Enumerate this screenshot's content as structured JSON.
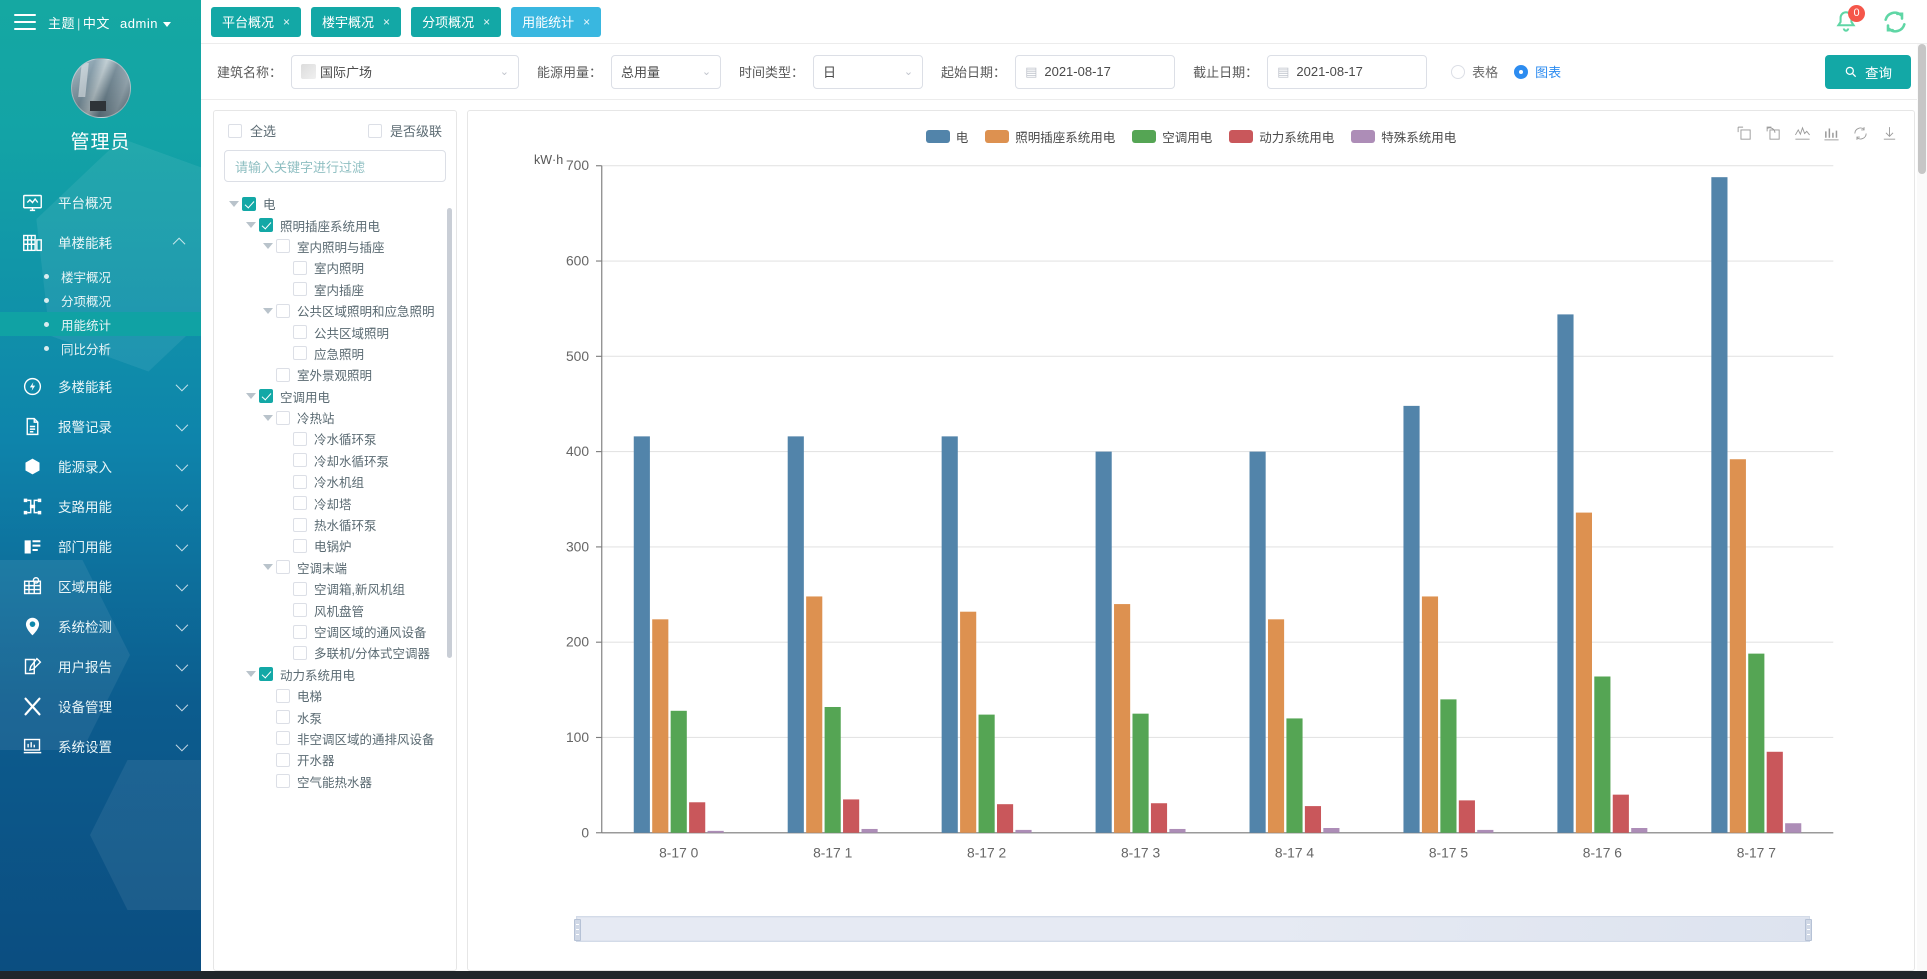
{
  "sidebar": {
    "header": {
      "theme_label": "主题",
      "separator": "|",
      "lang_label": "中文",
      "user": "admin"
    },
    "user_name": "管理员",
    "items": [
      {
        "label": "平台概况",
        "icon": "monitor-icon",
        "expandable": false
      },
      {
        "label": "单楼能耗",
        "icon": "building-icon",
        "expandable": true,
        "expanded": true,
        "children": [
          {
            "label": "楼宇概况",
            "active": false
          },
          {
            "label": "分项概况",
            "active": false
          },
          {
            "label": "用能统计",
            "active": true
          },
          {
            "label": "同比分析",
            "active": false
          }
        ]
      },
      {
        "label": "多楼能耗",
        "icon": "bolt-circle-icon",
        "expandable": true
      },
      {
        "label": "报警记录",
        "icon": "document-icon",
        "expandable": true
      },
      {
        "label": "能源录入",
        "icon": "hexagon-icon",
        "expandable": true
      },
      {
        "label": "支路用能",
        "icon": "nodes-icon",
        "expandable": true
      },
      {
        "label": "部门用能",
        "icon": "folder-icon",
        "expandable": true
      },
      {
        "label": "区域用能",
        "icon": "map-grid-icon",
        "expandable": true
      },
      {
        "label": "系统检测",
        "icon": "location-pin-icon",
        "expandable": true
      },
      {
        "label": "用户报告",
        "icon": "edit-square-icon",
        "expandable": true
      },
      {
        "label": "设备管理",
        "icon": "tools-icon",
        "expandable": true
      },
      {
        "label": "系统设置",
        "icon": "settings-monitor-icon",
        "expandable": true
      }
    ]
  },
  "topbar": {
    "tabs": [
      {
        "label": "平台概况",
        "active": false,
        "close": "×"
      },
      {
        "label": "楼宇概况",
        "active": false,
        "close": "×"
      },
      {
        "label": "分项概况",
        "active": false,
        "close": "×"
      },
      {
        "label": "用能统计",
        "active": true,
        "close": "×"
      }
    ],
    "notification_count": "0"
  },
  "filters": {
    "building": {
      "label": "建筑名称：",
      "value": "国际广场"
    },
    "energy": {
      "label": "能源用量：",
      "value": "总用量"
    },
    "timetype": {
      "label": "时间类型：",
      "value": "日"
    },
    "start": {
      "label": "起始日期：",
      "value": "2021-08-17"
    },
    "end": {
      "label": "截止日期：",
      "value": "2021-08-17"
    },
    "view_table": "表格",
    "view_chart": "图表",
    "view_selected": "图表",
    "search_button": "查询"
  },
  "tree": {
    "select_all": "全选",
    "cascade": "是否级联",
    "filter_placeholder": "请输入关键字进行过滤",
    "nodes": [
      {
        "label": "电",
        "depth": 0,
        "checked": true,
        "expandable": true
      },
      {
        "label": "照明插座系统用电",
        "depth": 1,
        "checked": true,
        "expandable": true
      },
      {
        "label": "室内照明与插座",
        "depth": 2,
        "checked": false,
        "expandable": true
      },
      {
        "label": "室内照明",
        "depth": 3,
        "checked": false,
        "expandable": false
      },
      {
        "label": "室内插座",
        "depth": 3,
        "checked": false,
        "expandable": false
      },
      {
        "label": "公共区域照明和应急照明",
        "depth": 2,
        "checked": false,
        "expandable": true
      },
      {
        "label": "公共区域照明",
        "depth": 3,
        "checked": false,
        "expandable": false
      },
      {
        "label": "应急照明",
        "depth": 3,
        "checked": false,
        "expandable": false
      },
      {
        "label": "室外景观照明",
        "depth": 2,
        "checked": false,
        "expandable": false
      },
      {
        "label": "空调用电",
        "depth": 1,
        "checked": true,
        "expandable": true
      },
      {
        "label": "冷热站",
        "depth": 2,
        "checked": false,
        "expandable": true
      },
      {
        "label": "冷水循环泵",
        "depth": 3,
        "checked": false,
        "expandable": false
      },
      {
        "label": "冷却水循环泵",
        "depth": 3,
        "checked": false,
        "expandable": false
      },
      {
        "label": "冷水机组",
        "depth": 3,
        "checked": false,
        "expandable": false
      },
      {
        "label": "冷却塔",
        "depth": 3,
        "checked": false,
        "expandable": false
      },
      {
        "label": "热水循环泵",
        "depth": 3,
        "checked": false,
        "expandable": false
      },
      {
        "label": "电锅炉",
        "depth": 3,
        "checked": false,
        "expandable": false
      },
      {
        "label": "空调末端",
        "depth": 2,
        "checked": false,
        "expandable": true
      },
      {
        "label": "空调箱,新风机组",
        "depth": 3,
        "checked": false,
        "expandable": false
      },
      {
        "label": "风机盘管",
        "depth": 3,
        "checked": false,
        "expandable": false
      },
      {
        "label": "空调区域的通风设备",
        "depth": 3,
        "checked": false,
        "expandable": false
      },
      {
        "label": "多联机/分体式空调器",
        "depth": 3,
        "checked": false,
        "expandable": false
      },
      {
        "label": "动力系统用电",
        "depth": 1,
        "checked": true,
        "expandable": true
      },
      {
        "label": "电梯",
        "depth": 2,
        "checked": false,
        "expandable": false
      },
      {
        "label": "水泵",
        "depth": 2,
        "checked": false,
        "expandable": false
      },
      {
        "label": "非空调区域的通排风设备",
        "depth": 2,
        "checked": false,
        "expandable": false
      },
      {
        "label": "开水器",
        "depth": 2,
        "checked": false,
        "expandable": false
      },
      {
        "label": "空气能热水器",
        "depth": 2,
        "checked": false,
        "expandable": false
      }
    ]
  },
  "chart_toolbox": [
    "datazoom-select-icon",
    "datazoom-restore-icon",
    "line-chart-icon",
    "bar-chart-icon",
    "restore-icon",
    "save-image-icon"
  ],
  "chart_data": {
    "type": "bar",
    "title": "",
    "xlabel": "",
    "ylabel": "kW·h",
    "ylim": [
      0,
      700
    ],
    "yticks": [
      0,
      100,
      200,
      300,
      400,
      500,
      600,
      700
    ],
    "grid": true,
    "legend_position": "top-center",
    "categories": [
      "8-17 0",
      "8-17 1",
      "8-17 2",
      "8-17 3",
      "8-17 4",
      "8-17 5",
      "8-17 6",
      "8-17 7"
    ],
    "series": [
      {
        "name": "电",
        "color": "#5284aa",
        "values": [
          416,
          416,
          416,
          400,
          400,
          448,
          544,
          688
        ]
      },
      {
        "name": "照明插座系统用电",
        "color": "#dd9150",
        "values": [
          224,
          248,
          232,
          240,
          224,
          248,
          336,
          392
        ]
      },
      {
        "name": "空调用电",
        "color": "#55a554",
        "values": [
          128,
          132,
          124,
          125,
          120,
          140,
          164,
          188
        ]
      },
      {
        "name": "动力系统用电",
        "color": "#c9575b",
        "values": [
          32,
          35,
          30,
          31,
          28,
          34,
          40,
          85
        ]
      },
      {
        "name": "特殊系统用电",
        "color": "#ad8db7",
        "values": [
          2,
          4,
          3,
          4,
          5,
          3,
          5,
          10
        ]
      }
    ]
  }
}
